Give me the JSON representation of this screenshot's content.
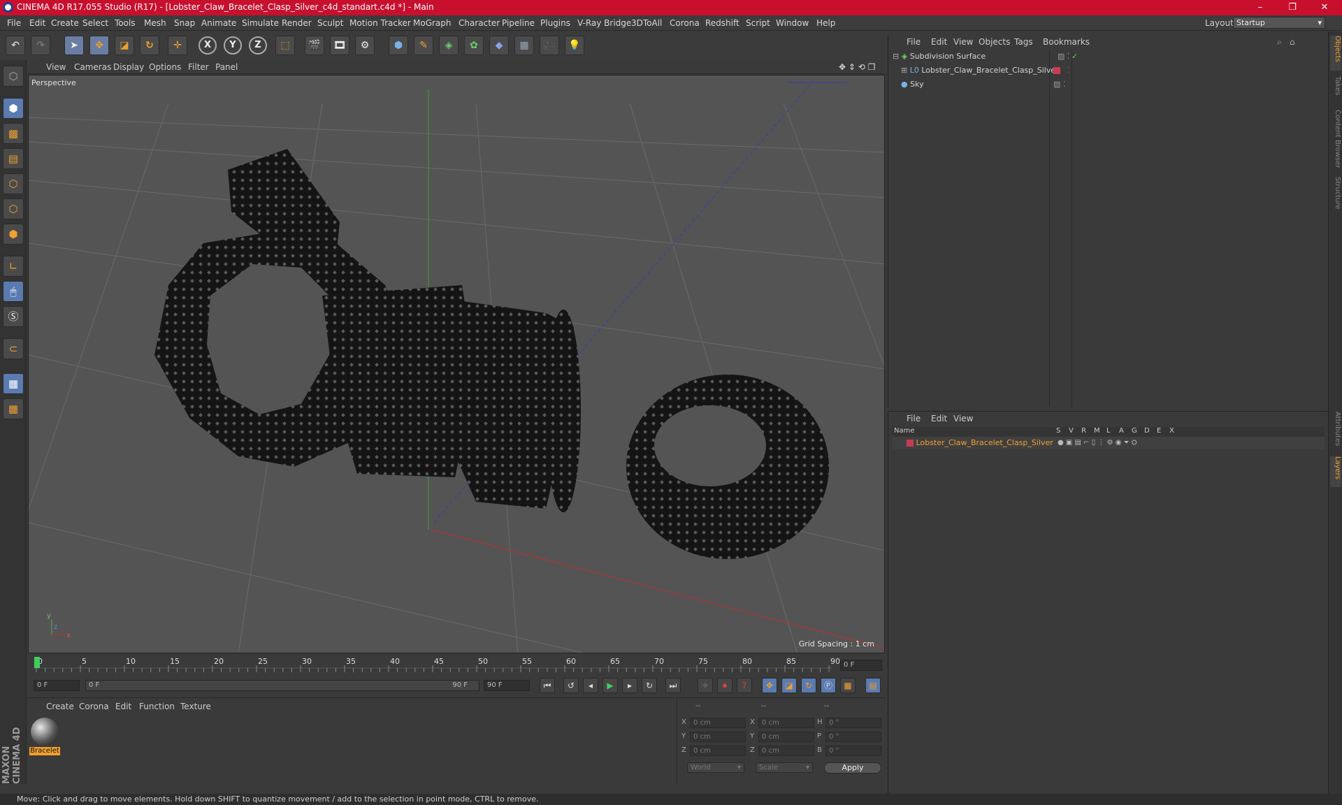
{
  "window": {
    "title": "CINEMA 4D R17.055 Studio (R17) - [Lobster_Claw_Bracelet_Clasp_Silver_c4d_standart.c4d *] - Main",
    "controls": [
      "–",
      "❐",
      "✕"
    ]
  },
  "menubar": {
    "items": [
      "File",
      "Edit",
      "Create",
      "Select",
      "Tools",
      "Mesh",
      "Snap",
      "Animate",
      "Simulate",
      "Render",
      "Sculpt",
      "Motion Tracker",
      "MoGraph",
      "Character",
      "Pipeline",
      "Plugins",
      "V-Ray Bridge",
      "3DToAll",
      "Corona",
      "Redshift",
      "Script",
      "Window",
      "Help"
    ],
    "layout_label": "Layout:",
    "layout_value": "Startup"
  },
  "toolbar": {
    "axis_x": "X",
    "axis_y": "Y",
    "axis_z": "Z"
  },
  "viewport": {
    "menu": [
      "View",
      "Cameras",
      "Display",
      "Options",
      "Filter",
      "Panel"
    ],
    "label": "Perspective",
    "grid_spacing": "Grid Spacing : 1 cm"
  },
  "timeline": {
    "ticks": [
      "0",
      "5",
      "10",
      "15",
      "20",
      "25",
      "30",
      "35",
      "40",
      "45",
      "50",
      "55",
      "60",
      "65",
      "70",
      "75",
      "80",
      "85",
      "90"
    ],
    "end_field": "0 F",
    "start_field": "0 F",
    "range_start": "0 F",
    "range_end": "90 F",
    "end_frame": "90 F"
  },
  "materials": {
    "menu": [
      "Create",
      "Corona",
      "Edit",
      "Function",
      "Texture"
    ],
    "items": [
      {
        "name": "Bracelet"
      }
    ]
  },
  "coords": {
    "header": [
      "--",
      "--",
      "--"
    ],
    "rows": [
      {
        "a": "X",
        "av": "0 cm",
        "b": "X",
        "bv": "0 cm",
        "c": "H",
        "cv": "0 °"
      },
      {
        "a": "Y",
        "av": "0 cm",
        "b": "Y",
        "bv": "0 cm",
        "c": "P",
        "cv": "0 °"
      },
      {
        "a": "Z",
        "av": "0 cm",
        "b": "Z",
        "bv": "0 cm",
        "c": "B",
        "cv": "0 °"
      }
    ],
    "world": "World",
    "scale": "Scale",
    "apply": "Apply"
  },
  "objects": {
    "menu": [
      "File",
      "Edit",
      "View",
      "Objects",
      "Tags",
      "Bookmarks"
    ],
    "items": [
      {
        "name": "Subdivision Surface"
      },
      {
        "name": "Lobster_Claw_Bracelet_Clasp_Silver"
      },
      {
        "name": "Sky"
      }
    ]
  },
  "layers": {
    "menu": [
      "File",
      "Edit",
      "View"
    ],
    "col_name": "Name",
    "cols": [
      "S",
      "V",
      "R",
      "M",
      "L",
      "A",
      "G",
      "D",
      "E",
      "X"
    ],
    "items": [
      {
        "name": "Lobster_Claw_Bracelet_Clasp_Silver"
      }
    ]
  },
  "right_tabs": [
    "Objects",
    "Takes",
    "Content Browser",
    "Structure",
    "Attributes",
    "Layers"
  ],
  "brand": "MAXON CINEMA 4D",
  "status": "Move: Click and drag to move elements. Hold down SHIFT to quantize movement / add to the selection in point mode, CTRL to remove.",
  "colors": {
    "titlebar": "#c8102e",
    "accent": "#f0a030",
    "layer_color": "#c83c50"
  }
}
